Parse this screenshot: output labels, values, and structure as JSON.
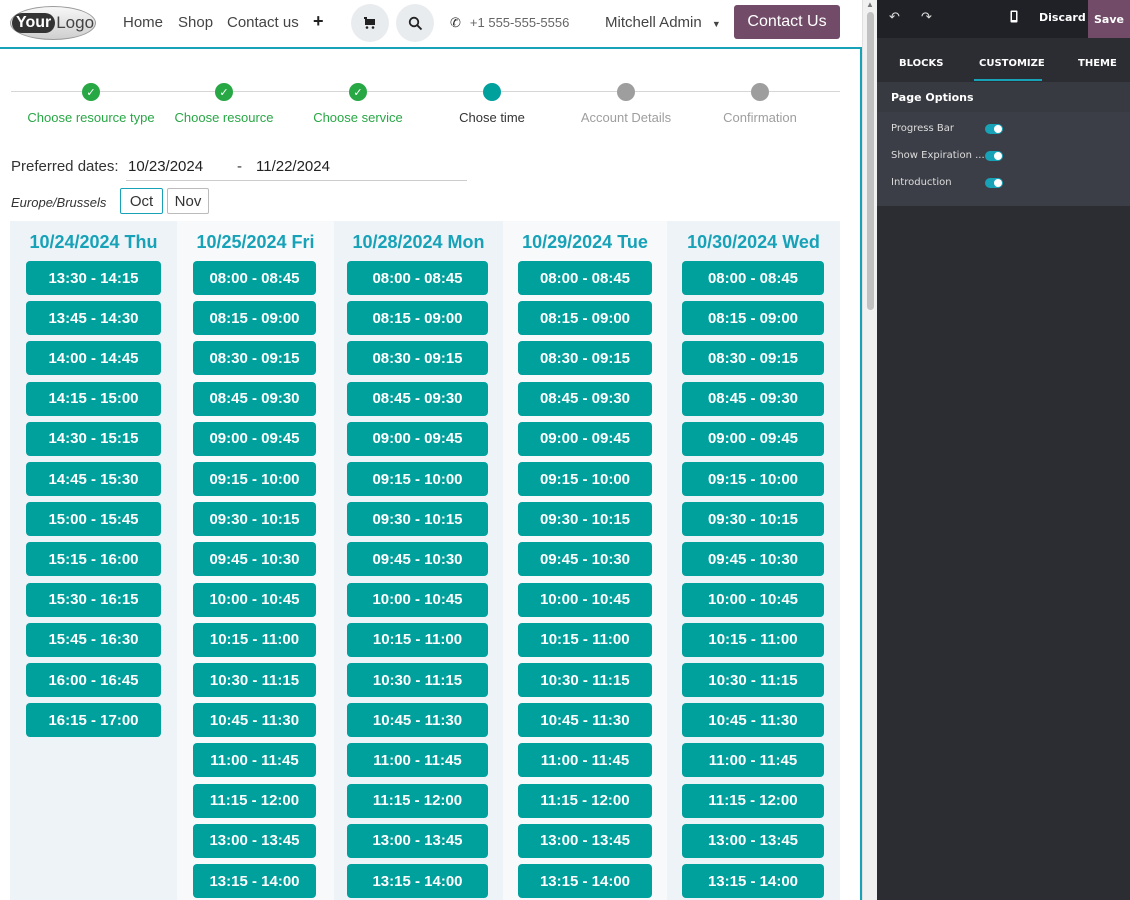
{
  "header": {
    "logo": {
      "bold": "Your",
      "rest": "Logo"
    },
    "nav": [
      "Home",
      "Shop",
      "Contact us"
    ],
    "phone": "+1 555-555-5556",
    "user": "Mitchell Admin",
    "cta": "Contact Us"
  },
  "steps": [
    {
      "label": "Choose resource type",
      "state": "done"
    },
    {
      "label": "Choose resource",
      "state": "done"
    },
    {
      "label": "Choose service",
      "state": "done"
    },
    {
      "label": "Chose time",
      "state": "current"
    },
    {
      "label": "Account Details",
      "state": "todo"
    },
    {
      "label": "Confirmation",
      "state": "todo"
    }
  ],
  "dates": {
    "label": "Preferred dates:",
    "from": "10/23/2024",
    "to": "11/22/2024",
    "sep": "-",
    "timezone": "Europe/Brussels",
    "months": [
      "Oct",
      "Nov"
    ]
  },
  "days": [
    {
      "title": "10/24/2024 Thu",
      "slots": [
        "13:30 - 14:15",
        "13:45 - 14:30",
        "14:00 - 14:45",
        "14:15 - 15:00",
        "14:30 - 15:15",
        "14:45 - 15:30",
        "15:00 - 15:45",
        "15:15 - 16:00",
        "15:30 - 16:15",
        "15:45 - 16:30",
        "16:00 - 16:45",
        "16:15 - 17:00"
      ]
    },
    {
      "title": "10/25/2024 Fri",
      "slots": [
        "08:00 - 08:45",
        "08:15 - 09:00",
        "08:30 - 09:15",
        "08:45 - 09:30",
        "09:00 - 09:45",
        "09:15 - 10:00",
        "09:30 - 10:15",
        "09:45 - 10:30",
        "10:00 - 10:45",
        "10:15 - 11:00",
        "10:30 - 11:15",
        "10:45 - 11:30",
        "11:00 - 11:45",
        "11:15 - 12:00",
        "13:00 - 13:45",
        "13:15 - 14:00"
      ]
    },
    {
      "title": "10/28/2024 Mon",
      "slots": [
        "08:00 - 08:45",
        "08:15 - 09:00",
        "08:30 - 09:15",
        "08:45 - 09:30",
        "09:00 - 09:45",
        "09:15 - 10:00",
        "09:30 - 10:15",
        "09:45 - 10:30",
        "10:00 - 10:45",
        "10:15 - 11:00",
        "10:30 - 11:15",
        "10:45 - 11:30",
        "11:00 - 11:45",
        "11:15 - 12:00",
        "13:00 - 13:45",
        "13:15 - 14:00"
      ]
    },
    {
      "title": "10/29/2024 Tue",
      "slots": [
        "08:00 - 08:45",
        "08:15 - 09:00",
        "08:30 - 09:15",
        "08:45 - 09:30",
        "09:00 - 09:45",
        "09:15 - 10:00",
        "09:30 - 10:15",
        "09:45 - 10:30",
        "10:00 - 10:45",
        "10:15 - 11:00",
        "10:30 - 11:15",
        "10:45 - 11:30",
        "11:00 - 11:45",
        "11:15 - 12:00",
        "13:00 - 13:45",
        "13:15 - 14:00"
      ]
    },
    {
      "title": "10/30/2024 Wed",
      "slots": [
        "08:00 - 08:45",
        "08:15 - 09:00",
        "08:30 - 09:15",
        "08:45 - 09:30",
        "09:00 - 09:45",
        "09:15 - 10:00",
        "09:30 - 10:15",
        "09:45 - 10:30",
        "10:00 - 10:45",
        "10:15 - 11:00",
        "10:30 - 11:15",
        "10:45 - 11:30",
        "11:00 - 11:45",
        "11:15 - 12:00",
        "13:00 - 13:45",
        "13:15 - 14:00"
      ]
    }
  ],
  "editor": {
    "discard": "Discard",
    "save": "Save",
    "tabs": [
      "BLOCKS",
      "CUSTOMIZE",
      "THEME"
    ],
    "section": "Page Options",
    "options": [
      {
        "label": "Progress Bar",
        "on": true
      },
      {
        "label": "Show Expiration ...",
        "on": true
      },
      {
        "label": "Introduction",
        "on": true
      }
    ]
  },
  "colors": {
    "accent": "#00a09d",
    "done": "#28a745",
    "brand": "#714b67",
    "editor_bg": "#2b2d33",
    "teal_text": "#17a2b8"
  }
}
